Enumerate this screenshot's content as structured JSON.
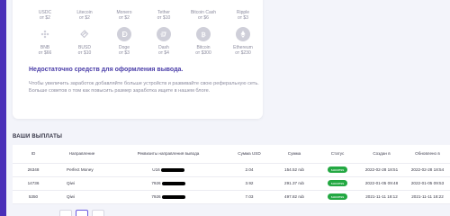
{
  "currencies_row1": [
    {
      "name": "USDC",
      "min": "от $2"
    },
    {
      "name": "Litecoin",
      "min": "от $2"
    },
    {
      "name": "Monero",
      "min": "от $2"
    },
    {
      "name": "Tether",
      "min": "от $10"
    },
    {
      "name": "Bitcoin Cash",
      "min": "от $6"
    },
    {
      "name": "Ripple",
      "min": "от $3"
    }
  ],
  "currencies_row2": [
    {
      "name": "BNB",
      "min": "от $66",
      "icon": "bnb-icon",
      "color": "#c9c9d4"
    },
    {
      "name": "BUSD",
      "min": "от $10",
      "icon": "busd-icon",
      "color": "#c9c9d4"
    },
    {
      "name": "Doge",
      "min": "от $3",
      "icon": "doge-icon",
      "color": "#c9c9d4"
    },
    {
      "name": "Dash",
      "min": "от $4",
      "icon": "dash-icon",
      "color": "#c9c9d4"
    },
    {
      "name": "Bitcoin",
      "min": "от $300",
      "icon": "bitcoin-icon",
      "color": "#c9c9d4"
    },
    {
      "name": "Ethereum",
      "min": "от $230",
      "icon": "ethereum-icon",
      "color": "#c9c9d4"
    }
  ],
  "warning": {
    "title": "Недостаточно средств для оформления вывода.",
    "text": "Чтобы увеличить заработок добавляйте больше устройств и развивайте свою реферальную сеть. Больше советов о том как повысить размер заработка ищите в нашем блоге."
  },
  "payouts": {
    "title": "ВАШИ ВЫПЛАТЫ",
    "columns": [
      "ID",
      "Направление",
      "Реквизиты направления вывода",
      "Сумма USD",
      "Сумма",
      "Статус",
      "Создан в",
      "Обновлено в"
    ],
    "rows": [
      {
        "id": "26348",
        "direction": "Perfect Money",
        "requisites": "U16",
        "usd": "2.04",
        "amount": "154.52 rub",
        "status": "success",
        "created": "2022-02-28 18:51",
        "updated": "2022-02-28 18:54"
      },
      {
        "id": "14736",
        "direction": "Qiwi",
        "requisites": "7926",
        "usd": "3.92",
        "amount": "291.37 rub",
        "status": "success",
        "created": "2022-01-05 09:48",
        "updated": "2022-01-05 09:53"
      },
      {
        "id": "5350",
        "direction": "Qiwi",
        "requisites": "7926",
        "usd": "7.03",
        "amount": "497.82 rub",
        "status": "success",
        "created": "2021-11-11 18:12",
        "updated": "2021-11-11 18:22"
      }
    ]
  },
  "colors": {
    "accent": "#4a2fb8",
    "success": "#23a842",
    "warning_title": "#4a3da8"
  }
}
